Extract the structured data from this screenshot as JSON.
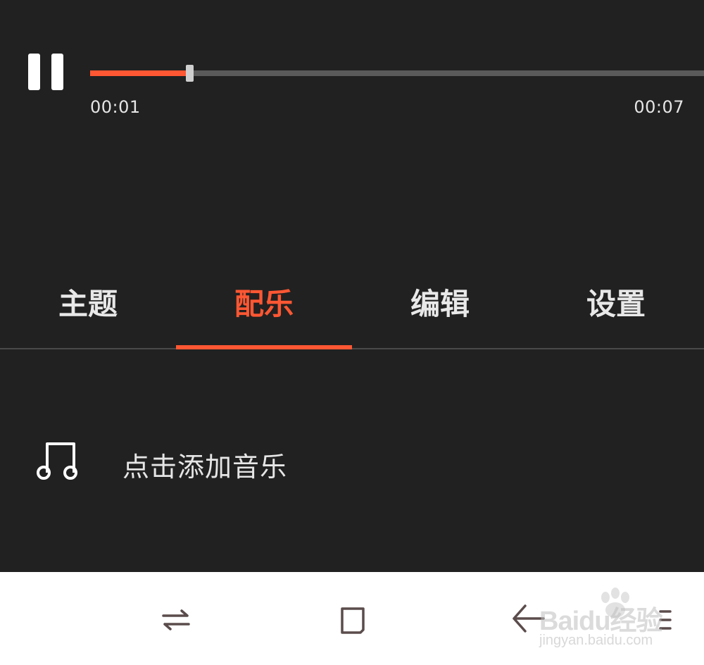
{
  "player": {
    "state": "playing",
    "progress": 0.162,
    "current_time": "00:01",
    "total_time": "00:07"
  },
  "tabs": [
    {
      "label": "主题",
      "active": false
    },
    {
      "label": "配乐",
      "active": true
    },
    {
      "label": "编辑",
      "active": false
    },
    {
      "label": "设置",
      "active": false
    }
  ],
  "add_music": {
    "icon": "music-note-icon",
    "label": "点击添加音乐"
  },
  "navbar": {
    "icons": [
      "switch-apps-icon",
      "home-icon",
      "back-icon",
      "menu-icon"
    ]
  },
  "watermark": {
    "brand": "Baidu经验",
    "url": "jingyan.baidu.com"
  },
  "colors": {
    "background": "#212121",
    "accent": "#ff5733",
    "track": "#5a5a5a",
    "text": "#e6e6e6",
    "navbar": "#ffffff",
    "nav_icon": "#5b4c4c"
  }
}
